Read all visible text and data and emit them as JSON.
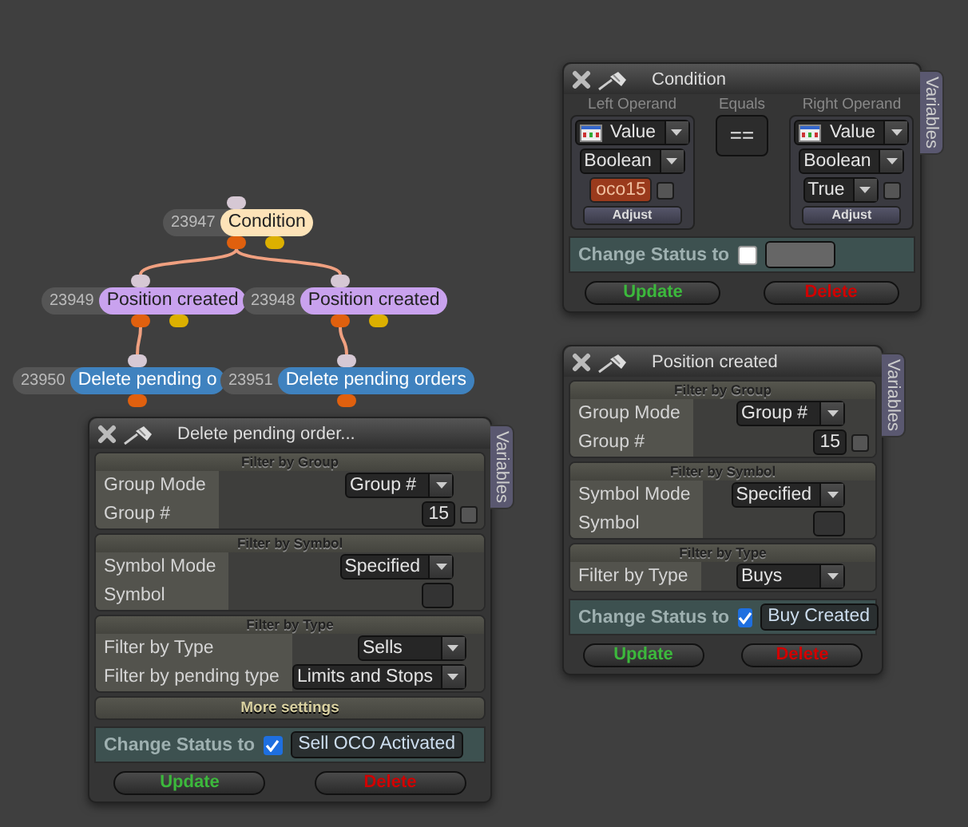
{
  "graph": {
    "nodes": [
      {
        "id": "23947",
        "label": "Condition",
        "kind": "condition",
        "children": [
          {
            "id": "23949",
            "label": "Position created",
            "kind": "position",
            "children": [
              {
                "id": "23950",
                "label": "Delete pending o",
                "kind": "delete"
              }
            ]
          },
          {
            "id": "23948",
            "label": "Position created",
            "kind": "position",
            "children": [
              {
                "id": "23951",
                "label": "Delete pending orders",
                "kind": "delete"
              }
            ]
          }
        ]
      }
    ]
  },
  "panels": [
    {
      "kind": "condition",
      "title": "Condition",
      "tab": "Variables",
      "operands": [
        {
          "header": "Left Operand",
          "source": "Value",
          "type": "Boolean",
          "value": "oco15",
          "kind": "variable",
          "checked": false,
          "adjust": "Adjust"
        },
        {
          "header": "Right Operand",
          "source": "Value",
          "type": "Boolean",
          "value": "True",
          "kind": "dropdown",
          "checked": false,
          "adjust": "Adjust"
        }
      ],
      "operator": {
        "header": "Equals",
        "symbol": "=="
      },
      "status": {
        "label": "Change Status to",
        "checked": false
      },
      "buttons": [
        {
          "label": "Update",
          "kind": "update"
        },
        {
          "label": "Delete",
          "kind": "delete"
        }
      ]
    },
    {
      "kind": "filter",
      "title": "Position created",
      "tab": "Variables",
      "sections": [
        {
          "header": "Filter by Group",
          "expanded": true,
          "rows": [
            {
              "label": "Group Mode",
              "kind": "dropdown",
              "value": "Group #"
            },
            {
              "label": "Group #",
              "kind": "number",
              "value": "15",
              "checked": false
            }
          ]
        },
        {
          "header": "Filter by Symbol",
          "expanded": true,
          "rows": [
            {
              "label": "Symbol Mode",
              "kind": "dropdown",
              "value": "Specified"
            },
            {
              "label": "Symbol",
              "kind": "field"
            }
          ]
        },
        {
          "header": "Filter by Type",
          "expanded": true,
          "rows": [
            {
              "label": "Filter by Type",
              "kind": "dropdown",
              "value": "Buys"
            }
          ]
        }
      ],
      "status": {
        "label": "Change Status to",
        "checked": true,
        "value": "Buy Created"
      },
      "buttons": [
        {
          "label": "Update",
          "kind": "update"
        },
        {
          "label": "Delete",
          "kind": "delete"
        }
      ]
    },
    {
      "kind": "filter",
      "title": "Delete pending order...",
      "tab": "Variables",
      "sections": [
        {
          "header": "Filter by Group",
          "expanded": true,
          "rows": [
            {
              "label": "Group Mode",
              "kind": "dropdown",
              "value": "Group #"
            },
            {
              "label": "Group #",
              "kind": "number",
              "value": "15",
              "checked": false
            }
          ]
        },
        {
          "header": "Filter by Symbol",
          "expanded": true,
          "rows": [
            {
              "label": "Symbol Mode",
              "kind": "dropdown",
              "value": "Specified"
            },
            {
              "label": "Symbol",
              "kind": "field"
            }
          ]
        },
        {
          "header": "Filter by Type",
          "expanded": true,
          "rows": [
            {
              "label": "Filter by Type",
              "kind": "dropdown",
              "value": "Sells"
            },
            {
              "label": "Filter by pending type",
              "kind": "dropdown",
              "value": "Limits and Stops"
            }
          ]
        },
        {
          "header": "More settings",
          "expanded": false
        }
      ],
      "status": {
        "label": "Change Status to",
        "checked": true,
        "value": "Sell OCO Activated"
      },
      "buttons": [
        {
          "label": "Update",
          "kind": "update"
        },
        {
          "label": "Delete",
          "kind": "delete"
        }
      ]
    }
  ]
}
